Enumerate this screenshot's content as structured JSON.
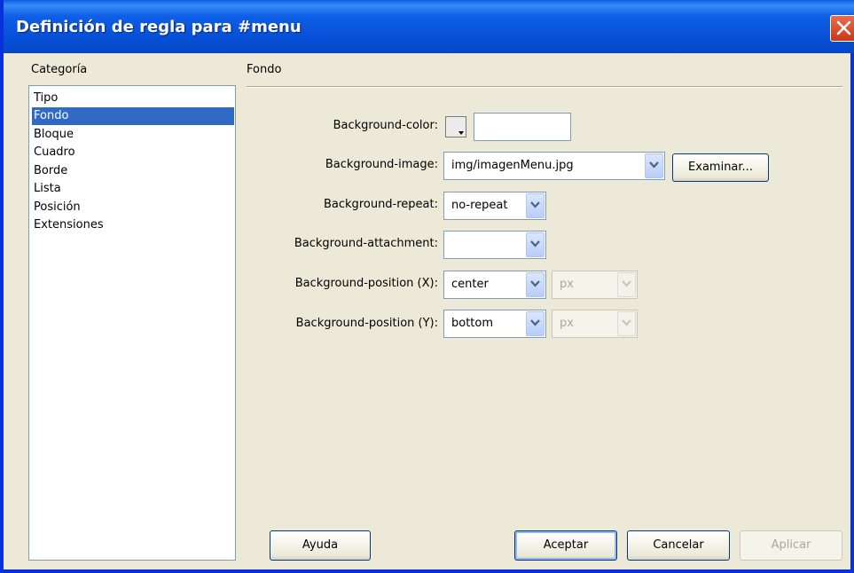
{
  "window": {
    "title": "Definición de regla para #menu"
  },
  "sidebar": {
    "heading": "Categoría",
    "items": [
      "Tipo",
      "Fondo",
      "Bloque",
      "Cuadro",
      "Borde",
      "Lista",
      "Posición",
      "Extensiones"
    ],
    "selected": "Fondo"
  },
  "panel": {
    "title": "Fondo",
    "bg_color": {
      "label": "Background-color:",
      "value": ""
    },
    "bg_image": {
      "label": "Background-image:",
      "value": "img/imagenMenu.jpg",
      "browse": "Examinar..."
    },
    "bg_repeat": {
      "label": "Background-repeat:",
      "value": "no-repeat"
    },
    "bg_attachment": {
      "label": "Background-attachment:",
      "value": ""
    },
    "bg_pos_x": {
      "label": "Background-position (X):",
      "value": "center",
      "unit": "px"
    },
    "bg_pos_y": {
      "label": "Background-position (Y):",
      "value": "bottom",
      "unit": "px"
    }
  },
  "buttons": {
    "help": "Ayuda",
    "ok": "Aceptar",
    "cancel": "Cancelar",
    "apply": "Aplicar"
  }
}
